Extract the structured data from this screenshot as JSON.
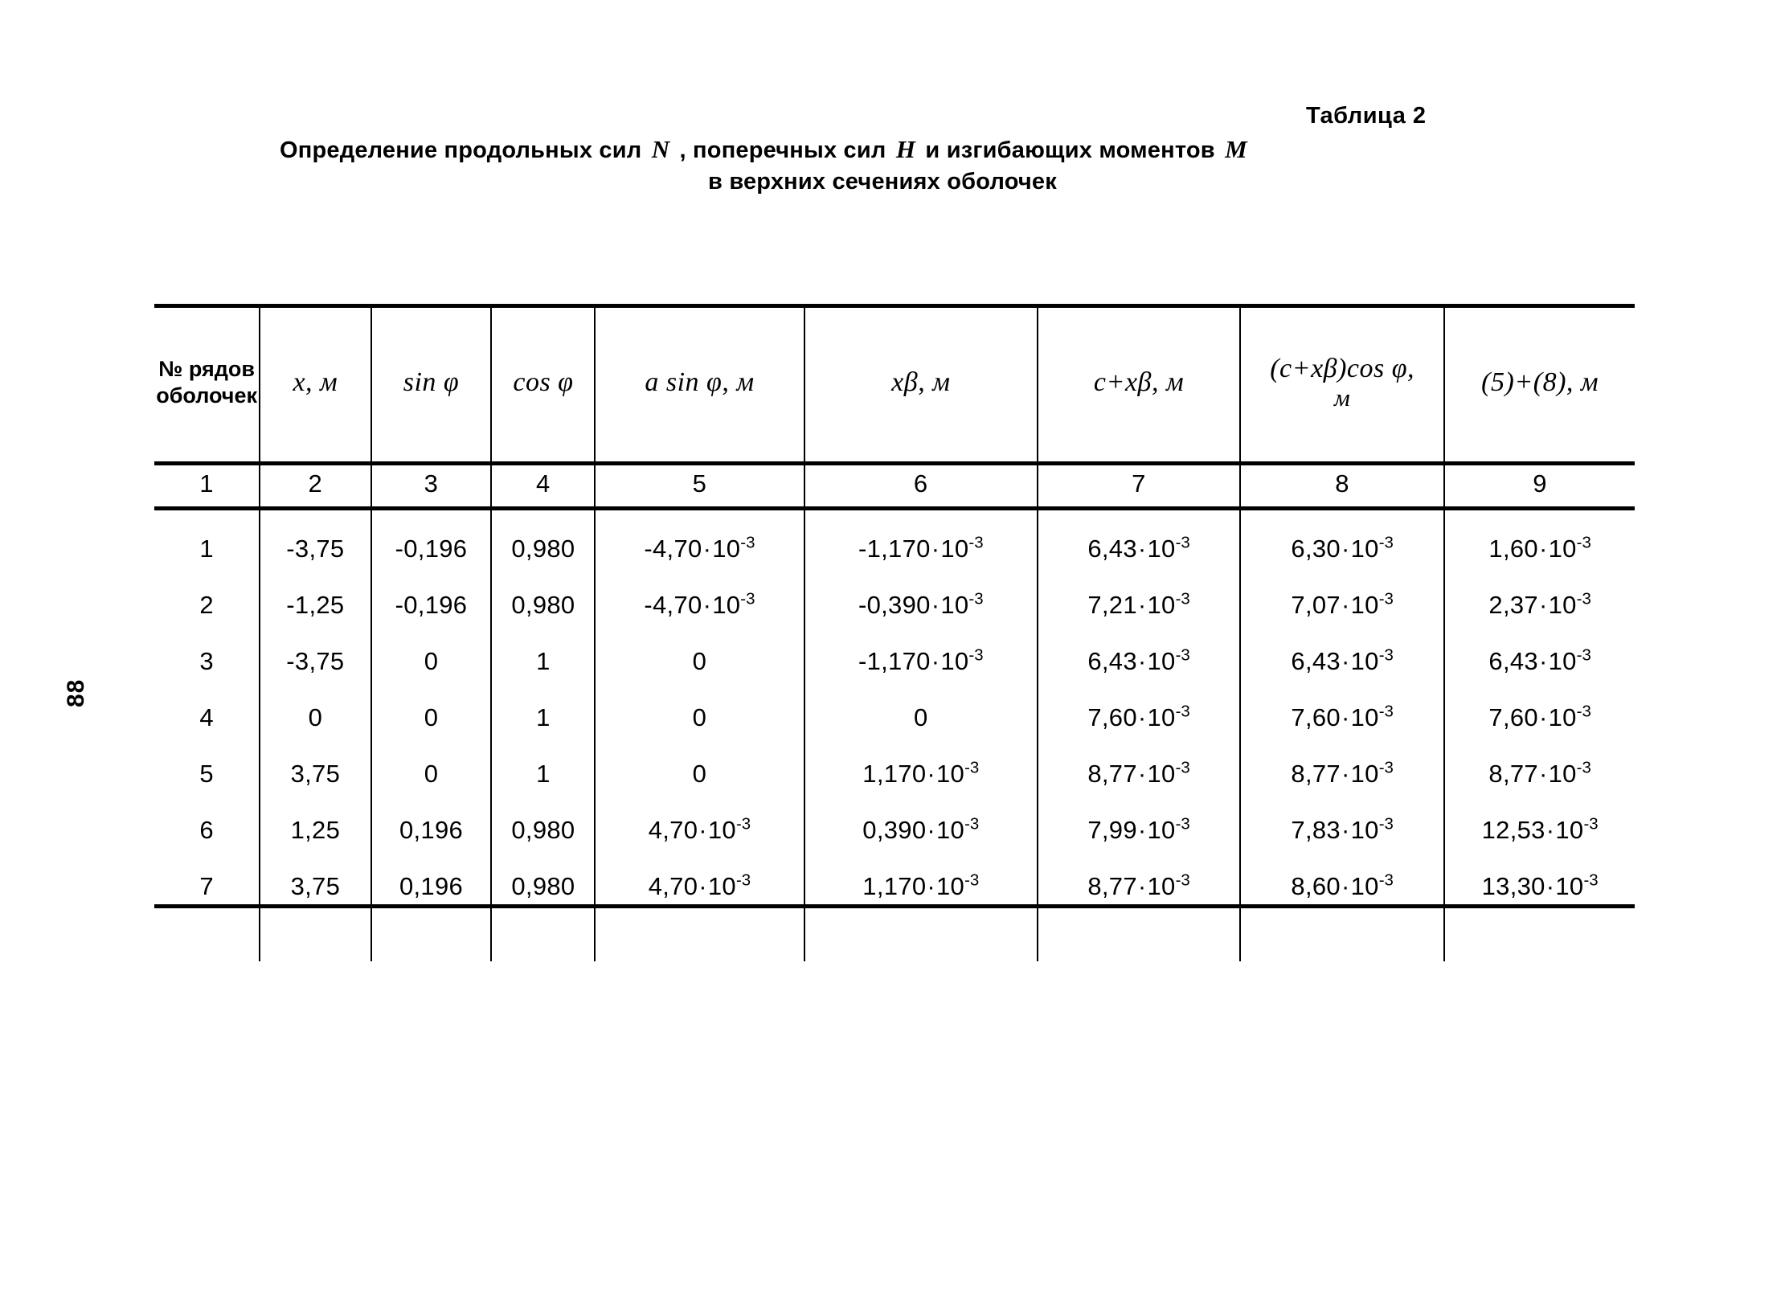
{
  "page": {
    "number": "88",
    "table_label": "Таблица 2",
    "caption_line1_before": "Определение продольных сил",
    "caption_var_n": "N",
    "caption_line1_mid": ", поперечных сил",
    "caption_var_h": "H",
    "caption_line1_after": "и изгибающих моментов",
    "caption_var_m": "M",
    "caption_line2": "в верхних сечениях оболочек"
  },
  "table": {
    "headers": [
      "№ рядов оболочек",
      "x, м",
      "sin φ",
      "cos φ",
      "a sin φ, м",
      "xβ, м",
      "c+xβ, м",
      "(c+xβ)cos φ,",
      "(5)+(8), м"
    ],
    "header_col8_second_line": "м",
    "column_numbers": [
      "1",
      "2",
      "3",
      "4",
      "5",
      "6",
      "7",
      "8",
      "9"
    ],
    "rows": [
      {
        "n": "1",
        "x": "-3,75",
        "sin": "-0,196",
        "cos": "0,980",
        "asin_mant": "-4,70",
        "asin_exp": "-3",
        "xb_mant": "-1,170",
        "xb_exp": "-3",
        "cxb_mant": "6,43",
        "cxb_exp": "-3",
        "cxbcos_mant": "6,30",
        "cxbcos_exp": "-3",
        "sum_mant": "1,60",
        "sum_exp": "-3"
      },
      {
        "n": "2",
        "x": "-1,25",
        "sin": "-0,196",
        "cos": "0,980",
        "asin_mant": "-4,70",
        "asin_exp": "-3",
        "xb_mant": "-0,390",
        "xb_exp": "-3",
        "cxb_mant": "7,21",
        "cxb_exp": "-3",
        "cxbcos_mant": "7,07",
        "cxbcos_exp": "-3",
        "sum_mant": "2,37",
        "sum_exp": "-3"
      },
      {
        "n": "3",
        "x": "-3,75",
        "sin": "0",
        "cos": "1",
        "asin_mant": "0",
        "asin_exp": "",
        "xb_mant": "-1,170",
        "xb_exp": "-3",
        "cxb_mant": "6,43",
        "cxb_exp": "-3",
        "cxbcos_mant": "6,43",
        "cxbcos_exp": "-3",
        "sum_mant": "6,43",
        "sum_exp": "-3"
      },
      {
        "n": "4",
        "x": "0",
        "sin": "0",
        "cos": "1",
        "asin_mant": "0",
        "asin_exp": "",
        "xb_mant": "0",
        "xb_exp": "",
        "cxb_mant": "7,60",
        "cxb_exp": "-3",
        "cxbcos_mant": "7,60",
        "cxbcos_exp": "-3",
        "sum_mant": "7,60",
        "sum_exp": "-3"
      },
      {
        "n": "5",
        "x": "3,75",
        "sin": "0",
        "cos": "1",
        "asin_mant": "0",
        "asin_exp": "",
        "xb_mant": "1,170",
        "xb_exp": "-3",
        "cxb_mant": "8,77",
        "cxb_exp": "-3",
        "cxbcos_mant": "8,77",
        "cxbcos_exp": "-3",
        "sum_mant": "8,77",
        "sum_exp": "-3"
      },
      {
        "n": "6",
        "x": "1,25",
        "sin": "0,196",
        "cos": "0,980",
        "asin_mant": "4,70",
        "asin_exp": "-3",
        "xb_mant": "0,390",
        "xb_exp": "-3",
        "cxb_mant": "7,99",
        "cxb_exp": "-3",
        "cxbcos_mant": "7,83",
        "cxbcos_exp": "-3",
        "sum_mant": "12,53",
        "sum_exp": "-3"
      },
      {
        "n": "7",
        "x": "3,75",
        "sin": "0,196",
        "cos": "0,980",
        "asin_mant": "4,70",
        "asin_exp": "-3",
        "xb_mant": "1,170",
        "xb_exp": "-3",
        "cxb_mant": "8,77",
        "cxb_exp": "-3",
        "cxbcos_mant": "8,60",
        "cxbcos_exp": "-3",
        "sum_mant": "13,30",
        "sum_exp": "-3"
      }
    ],
    "multiplier_base": "10"
  }
}
